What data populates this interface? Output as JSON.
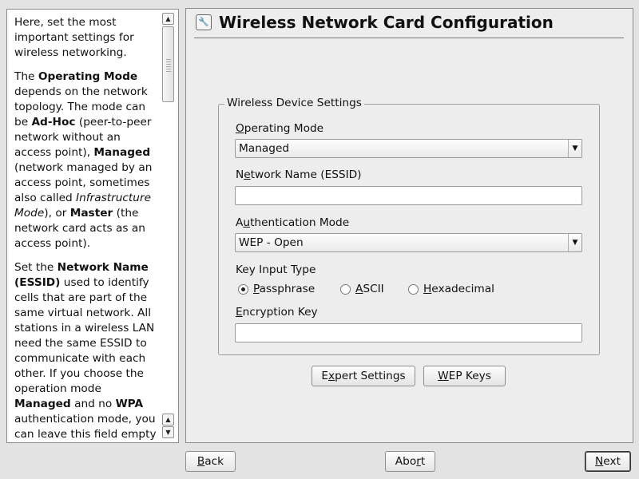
{
  "help": {
    "p1": "Here, set the most important settings for wireless networking.",
    "p2": {
      "t1": "The ",
      "b1": "Operating Mode",
      "t2": " depends on the network topology. The mode can be ",
      "b2": "Ad-Hoc",
      "t3": " (peer-to-peer network without an access point), ",
      "b3": "Managed",
      "t4": " (network managed by an access point, sometimes also called ",
      "i1": "Infrastructure Mode",
      "t5": "), or ",
      "b4": "Master",
      "t6": " (the network card acts as an access point)."
    },
    "p3": {
      "t1": "Set the ",
      "b1": "Network Name (ESSID)",
      "t2": " used to identify cells that are part of the same virtual network. All stations in a wireless LAN need the same ESSID to communicate with each other. If you choose the operation mode ",
      "b2": "Managed",
      "t3": " and no ",
      "b3": "WPA",
      "t4": " authentication mode, you can leave this field empty or set it to any."
    }
  },
  "title": "Wireless Network Card Configuration",
  "group": {
    "title": "Wireless Device Settings",
    "operating_mode": {
      "u": "O",
      "rest": "perating Mode",
      "value": "Managed"
    },
    "network_name": {
      "pre": "N",
      "u": "e",
      "rest": "twork Name (ESSID)",
      "value": ""
    },
    "auth_mode": {
      "pre": "A",
      "u": "u",
      "rest": "thentication Mode",
      "value": "WEP - Open"
    },
    "key_input_type": "Key Input Type",
    "radios": {
      "passphrase": {
        "u": "P",
        "rest": "assphrase",
        "checked": true
      },
      "ascii": {
        "u": "A",
        "rest": "SCII",
        "checked": false
      },
      "hex": {
        "u": "H",
        "rest": "exadecimal",
        "checked": false
      }
    },
    "enc_key": {
      "u": "E",
      "rest": "ncryption Key",
      "value": ""
    }
  },
  "buttons": {
    "expert": {
      "pre": "E",
      "u": "x",
      "rest": "pert Settings"
    },
    "wep": {
      "u": "W",
      "rest": "EP Keys"
    },
    "back": {
      "u": "B",
      "rest": "ack"
    },
    "abort": {
      "pre": "Abo",
      "u": "r",
      "rest": "t"
    },
    "next": {
      "u": "N",
      "rest": "ext"
    }
  }
}
